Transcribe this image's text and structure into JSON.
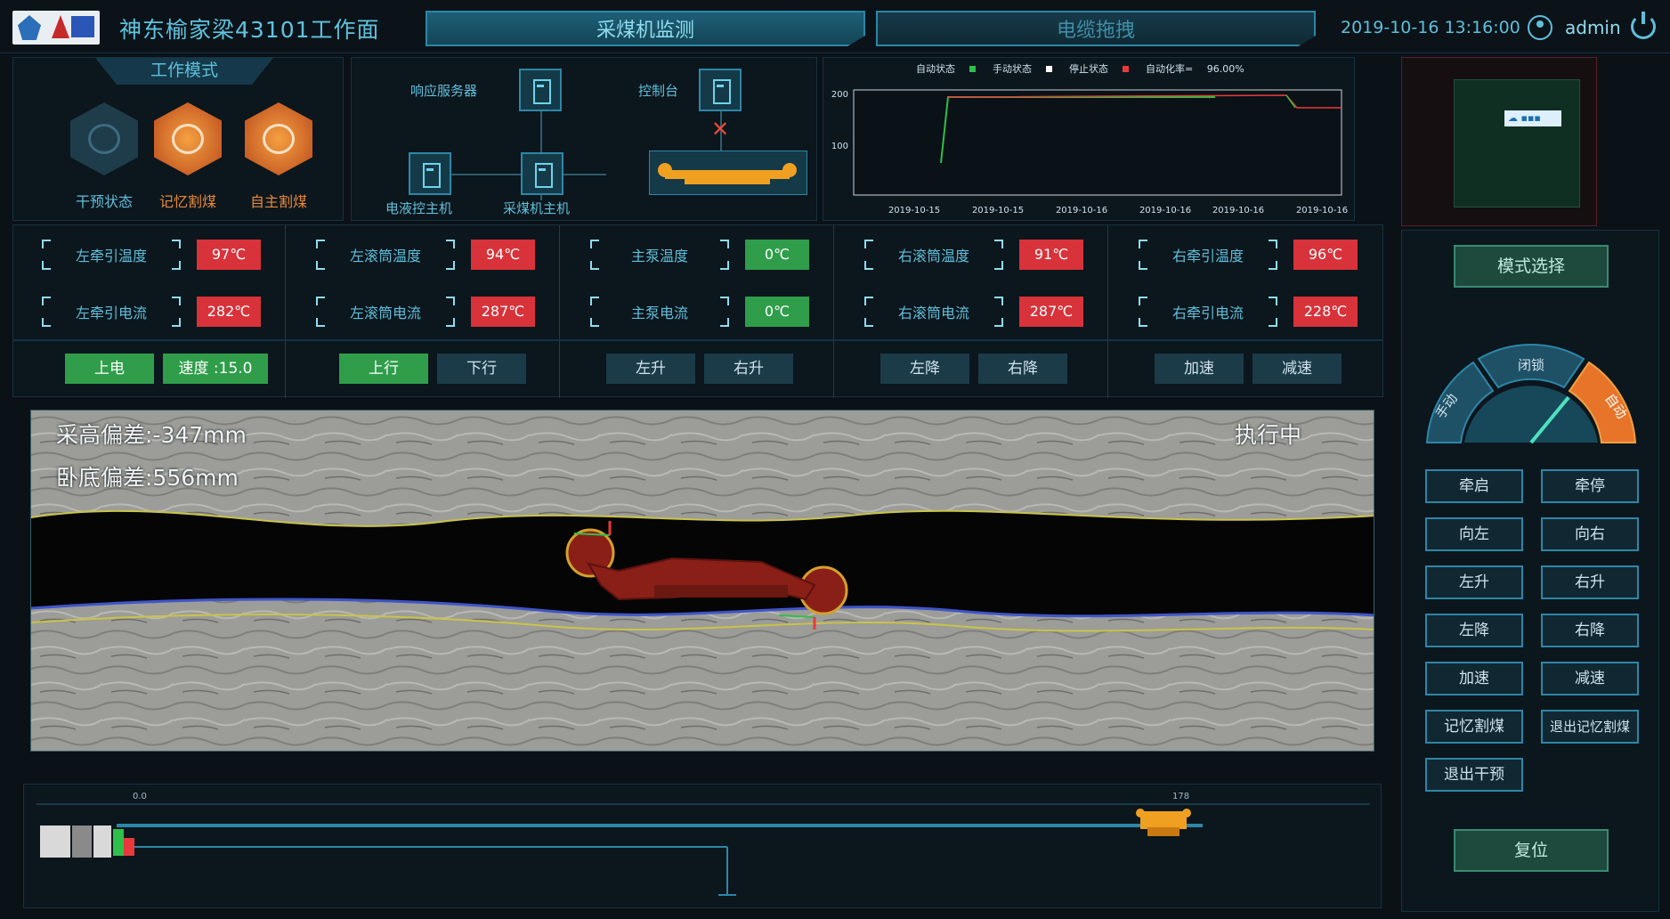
{
  "header": {
    "title": "神东榆家梁43101工作面",
    "tabs": [
      {
        "label": "采煤机监测",
        "active": true
      },
      {
        "label": "电缆拖拽",
        "active": false
      }
    ],
    "datetime": "2019-10-16 13:16:00",
    "username": "admin"
  },
  "work_mode": {
    "title": "工作模式",
    "modes": [
      {
        "label": "干预状态",
        "icon": "target-icon",
        "active": false
      },
      {
        "label": "记忆割煤",
        "icon": "brain-icon",
        "active": true
      },
      {
        "label": "自主割煤",
        "icon": "gear-icon",
        "active": true
      }
    ]
  },
  "network": {
    "nodes": [
      {
        "label": "响应服务器"
      },
      {
        "label": "控制台"
      },
      {
        "label": "电液控主机"
      },
      {
        "label": "采煤机主机"
      }
    ],
    "console_status": "✕"
  },
  "trend": {
    "legend": [
      {
        "label": "自动状态",
        "color": "#ffffff"
      },
      {
        "label": "手动状态",
        "color": "#2fbf4a"
      },
      {
        "label": "停止状态",
        "color": "#ffffff"
      },
      {
        "label": "自动化率=",
        "color": "#e83a3a"
      }
    ],
    "rate_value": "96.00%",
    "y_ticks": [
      "200",
      "100"
    ],
    "x_ticks": [
      "2019-10-15",
      "2019-10-15",
      "2019-10-16",
      "2019-10-16",
      "2019-10-16",
      "2019-10-16"
    ]
  },
  "sensors": {
    "groups": [
      {
        "items": [
          {
            "name": "左牵引温度",
            "value": "97℃",
            "status": "red"
          },
          {
            "name": "左牵引电流",
            "value": "282℃",
            "status": "red"
          }
        ]
      },
      {
        "items": [
          {
            "name": "左滚筒温度",
            "value": "94℃",
            "status": "red"
          },
          {
            "name": "左滚筒电流",
            "value": "287℃",
            "status": "red"
          }
        ]
      },
      {
        "items": [
          {
            "name": "主泵温度",
            "value": "0℃",
            "status": "green"
          },
          {
            "name": "主泵电流",
            "value": "0℃",
            "status": "green"
          }
        ]
      },
      {
        "items": [
          {
            "name": "右滚筒温度",
            "value": "91℃",
            "status": "red"
          },
          {
            "name": "右滚筒电流",
            "value": "287℃",
            "status": "red"
          }
        ]
      },
      {
        "items": [
          {
            "name": "右牵引温度",
            "value": "96℃",
            "status": "red"
          },
          {
            "name": "右牵引电流",
            "value": "228℃",
            "status": "red"
          }
        ]
      }
    ]
  },
  "controls": {
    "groups": [
      {
        "buttons": [
          {
            "label": "上电",
            "style": "green"
          },
          {
            "label": "速度 :15.0",
            "style": "green"
          }
        ]
      },
      {
        "buttons": [
          {
            "label": "上行",
            "style": "green"
          },
          {
            "label": "下行",
            "style": "dark"
          }
        ]
      },
      {
        "buttons": [
          {
            "label": "左升",
            "style": "dark"
          },
          {
            "label": "右升",
            "style": "dark"
          }
        ]
      },
      {
        "buttons": [
          {
            "label": "左降",
            "style": "dark"
          },
          {
            "label": "右降",
            "style": "dark"
          }
        ]
      },
      {
        "buttons": [
          {
            "label": "加速",
            "style": "dark"
          },
          {
            "label": "减速",
            "style": "dark"
          }
        ]
      }
    ]
  },
  "scene": {
    "height_deviation": "采高偏差:-347mm",
    "floor_deviation": "卧底偏差:556mm",
    "status": "执行中"
  },
  "track": {
    "start_label": "0.0",
    "end_label": "178"
  },
  "side_panel": {
    "mode_select": "模式选择",
    "gauge_segments": [
      "手动",
      "闭锁",
      "自动"
    ],
    "gauge_value_fraction": 0.72,
    "buttons": [
      "牵启",
      "牵停",
      "向左",
      "向右",
      "左升",
      "右升",
      "左降",
      "右降",
      "加速",
      "减速",
      "记忆割煤",
      "退出记忆割煤",
      "退出干预"
    ],
    "reset": "复位"
  },
  "colors": {
    "accent": "#5fbfda",
    "alarm": "#d8323a",
    "ok": "#2f9d4a",
    "active_mode": "#e8893a"
  }
}
